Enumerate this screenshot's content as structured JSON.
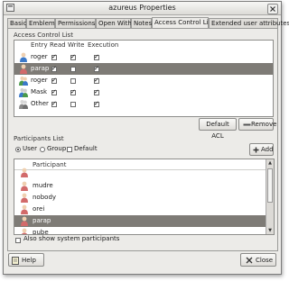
{
  "window": {
    "title": "azureus Properties"
  },
  "tabs": [
    {
      "label": "Basic"
    },
    {
      "label": "Emblems"
    },
    {
      "label": "Permissions"
    },
    {
      "label": "Open With"
    },
    {
      "label": "Notes"
    },
    {
      "label": "Access Control List"
    },
    {
      "label": "Extended user attributes"
    }
  ],
  "acl": {
    "section_label": "Access Control List",
    "columns": {
      "entry": "Entry",
      "read": "Read",
      "write": "Write",
      "execution": "Execution"
    },
    "rows": [
      {
        "name": "roger",
        "icon": "user-icon",
        "read": true,
        "write": true,
        "execution": true,
        "selected": false
      },
      {
        "name": "parap",
        "icon": "user-red-icon",
        "read": true,
        "write": false,
        "execution": true,
        "selected": true
      },
      {
        "name": "roger",
        "icon": "group-icon",
        "read": true,
        "write": false,
        "execution": true,
        "selected": false
      },
      {
        "name": "Mask",
        "icon": "mask-icon",
        "read": true,
        "write": true,
        "execution": true,
        "selected": false
      },
      {
        "name": "Other",
        "icon": "other-icon",
        "read": true,
        "write": false,
        "execution": true,
        "selected": false
      }
    ],
    "default_acl_button": "Default ACL",
    "remove_button": "Remove"
  },
  "participants": {
    "section_label": "Participants List",
    "radio_user": "User",
    "radio_group": "Group",
    "default_label": "Default",
    "add_button": "Add",
    "column": "Participant",
    "rows": [
      {
        "name": "",
        "selected": false
      },
      {
        "name": "mudre",
        "selected": false
      },
      {
        "name": "nobody",
        "selected": false
      },
      {
        "name": "orei",
        "selected": false
      },
      {
        "name": "parap",
        "selected": true
      },
      {
        "name": "pube",
        "selected": false
      }
    ],
    "show_system_label": "Also show system participants"
  },
  "footer": {
    "help_button": "Help",
    "close_button": "Close"
  },
  "colors": {
    "selected_row": "#7e7b76",
    "user_blue": "#3b79c9",
    "user_red": "#d26a6a",
    "user_green": "#4a9a4a",
    "mask_gray": "#8a8a8a"
  }
}
